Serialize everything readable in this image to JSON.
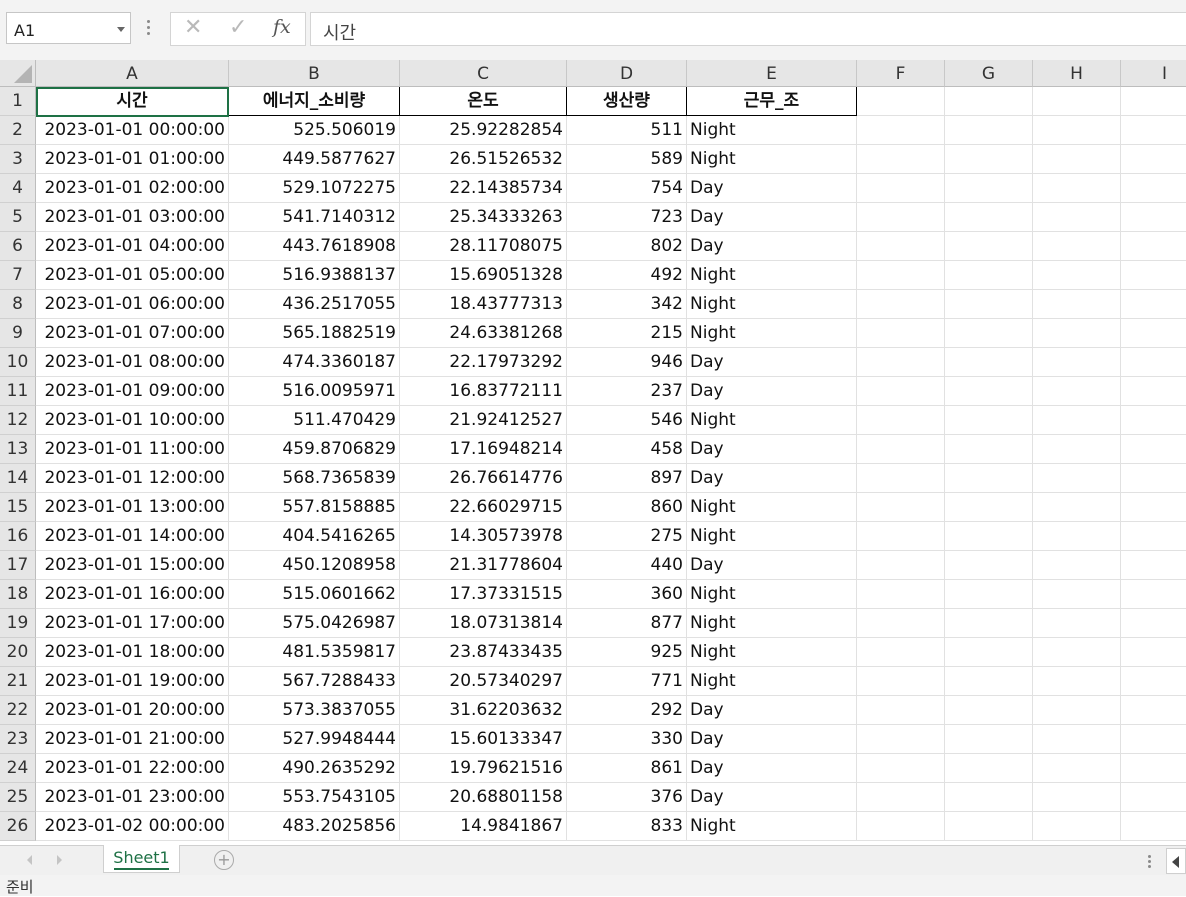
{
  "formula_bar": {
    "name_box": "A1",
    "cancel_icon": "✕",
    "enter_icon": "✓",
    "fx_label": "fx",
    "formula_value": "시간"
  },
  "columns": [
    "A",
    "B",
    "C",
    "D",
    "E",
    "F",
    "G",
    "H",
    "I"
  ],
  "header_row": [
    "시간",
    "에너지_소비량",
    "온도",
    "생산량",
    "근무_조"
  ],
  "rows": [
    [
      "2023-01-01 00:00:00",
      "525.506019",
      "25.92282854",
      "511",
      "Night"
    ],
    [
      "2023-01-01 01:00:00",
      "449.5877627",
      "26.51526532",
      "589",
      "Night"
    ],
    [
      "2023-01-01 02:00:00",
      "529.1072275",
      "22.14385734",
      "754",
      "Day"
    ],
    [
      "2023-01-01 03:00:00",
      "541.7140312",
      "25.34333263",
      "723",
      "Day"
    ],
    [
      "2023-01-01 04:00:00",
      "443.7618908",
      "28.11708075",
      "802",
      "Day"
    ],
    [
      "2023-01-01 05:00:00",
      "516.9388137",
      "15.69051328",
      "492",
      "Night"
    ],
    [
      "2023-01-01 06:00:00",
      "436.2517055",
      "18.43777313",
      "342",
      "Night"
    ],
    [
      "2023-01-01 07:00:00",
      "565.1882519",
      "24.63381268",
      "215",
      "Night"
    ],
    [
      "2023-01-01 08:00:00",
      "474.3360187",
      "22.17973292",
      "946",
      "Day"
    ],
    [
      "2023-01-01 09:00:00",
      "516.0095971",
      "16.83772111",
      "237",
      "Day"
    ],
    [
      "2023-01-01 10:00:00",
      "511.470429",
      "21.92412527",
      "546",
      "Night"
    ],
    [
      "2023-01-01 11:00:00",
      "459.8706829",
      "17.16948214",
      "458",
      "Day"
    ],
    [
      "2023-01-01 12:00:00",
      "568.7365839",
      "26.76614776",
      "897",
      "Day"
    ],
    [
      "2023-01-01 13:00:00",
      "557.8158885",
      "22.66029715",
      "860",
      "Night"
    ],
    [
      "2023-01-01 14:00:00",
      "404.5416265",
      "14.30573978",
      "275",
      "Night"
    ],
    [
      "2023-01-01 15:00:00",
      "450.1208958",
      "21.31778604",
      "440",
      "Day"
    ],
    [
      "2023-01-01 16:00:00",
      "515.0601662",
      "17.37331515",
      "360",
      "Night"
    ],
    [
      "2023-01-01 17:00:00",
      "575.0426987",
      "18.07313814",
      "877",
      "Night"
    ],
    [
      "2023-01-01 18:00:00",
      "481.5359817",
      "23.87433435",
      "925",
      "Night"
    ],
    [
      "2023-01-01 19:00:00",
      "567.7288433",
      "20.57340297",
      "771",
      "Night"
    ],
    [
      "2023-01-01 20:00:00",
      "573.3837055",
      "31.62203632",
      "292",
      "Day"
    ],
    [
      "2023-01-01 21:00:00",
      "527.9948444",
      "15.60133347",
      "330",
      "Day"
    ],
    [
      "2023-01-01 22:00:00",
      "490.2635292",
      "19.79621516",
      "861",
      "Day"
    ],
    [
      "2023-01-01 23:00:00",
      "553.7543105",
      "20.68801158",
      "376",
      "Day"
    ],
    [
      "2023-01-02 00:00:00",
      "483.2025856",
      "14.9841867",
      "833",
      "Night"
    ]
  ],
  "sheet_tabs": [
    "Sheet1"
  ],
  "add_sheet_icon": "+",
  "status": "준비",
  "accent_color": "#1e7145"
}
